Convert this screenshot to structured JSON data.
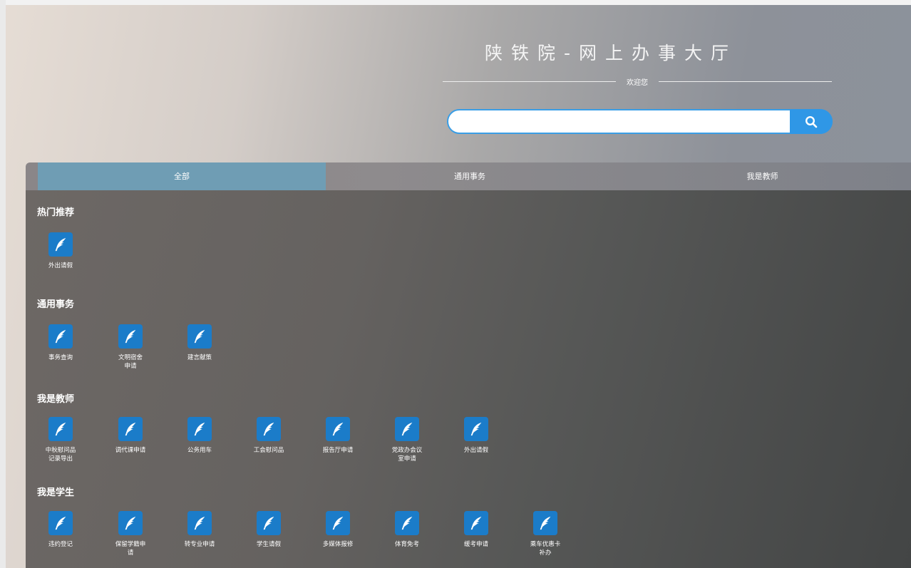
{
  "header": {
    "title": "陕铁院-网上办事大厅",
    "welcome": "欢迎您"
  },
  "search": {
    "value": "",
    "placeholder": ""
  },
  "tabs": [
    {
      "label": "全部",
      "active": true
    },
    {
      "label": "通用事务",
      "active": false
    },
    {
      "label": "我是教师",
      "active": false
    }
  ],
  "sections": [
    {
      "heading": "热门推荐",
      "items": [
        {
          "label": "外出请假",
          "icon": "quill-icon"
        }
      ]
    },
    {
      "heading": "通用事务",
      "items": [
        {
          "label": "事务查询",
          "icon": "quill-icon"
        },
        {
          "label": "文明宿舍申请",
          "icon": "quill-icon"
        },
        {
          "label": "建言献策",
          "icon": "quill-icon"
        }
      ]
    },
    {
      "heading": "我是教师",
      "items": [
        {
          "label": "中秋慰问品记录导出",
          "icon": "quill-icon"
        },
        {
          "label": "调代课申请",
          "icon": "quill-icon"
        },
        {
          "label": "公务用车",
          "icon": "quill-icon"
        },
        {
          "label": "工会慰问品",
          "icon": "quill-icon"
        },
        {
          "label": "报告厅申请",
          "icon": "quill-icon"
        },
        {
          "label": "党政办会议室申请",
          "icon": "quill-icon"
        },
        {
          "label": "外出请假",
          "icon": "quill-icon"
        }
      ]
    },
    {
      "heading": "我是学生",
      "items": [
        {
          "label": "违约登记",
          "icon": "quill-icon"
        },
        {
          "label": "保留学籍申请",
          "icon": "quill-icon"
        },
        {
          "label": "转专业申请",
          "icon": "quill-icon"
        },
        {
          "label": "学生请假",
          "icon": "quill-icon"
        },
        {
          "label": "多媒体报修",
          "icon": "quill-icon"
        },
        {
          "label": "体育免考",
          "icon": "quill-icon"
        },
        {
          "label": "缓考申请",
          "icon": "quill-icon"
        },
        {
          "label": "乘车优惠卡补办",
          "icon": "quill-icon"
        }
      ]
    }
  ],
  "colors": {
    "accent": "#2f97e6",
    "active_tab": "#6f9db4",
    "tile_icon": "#1b7cc9"
  }
}
